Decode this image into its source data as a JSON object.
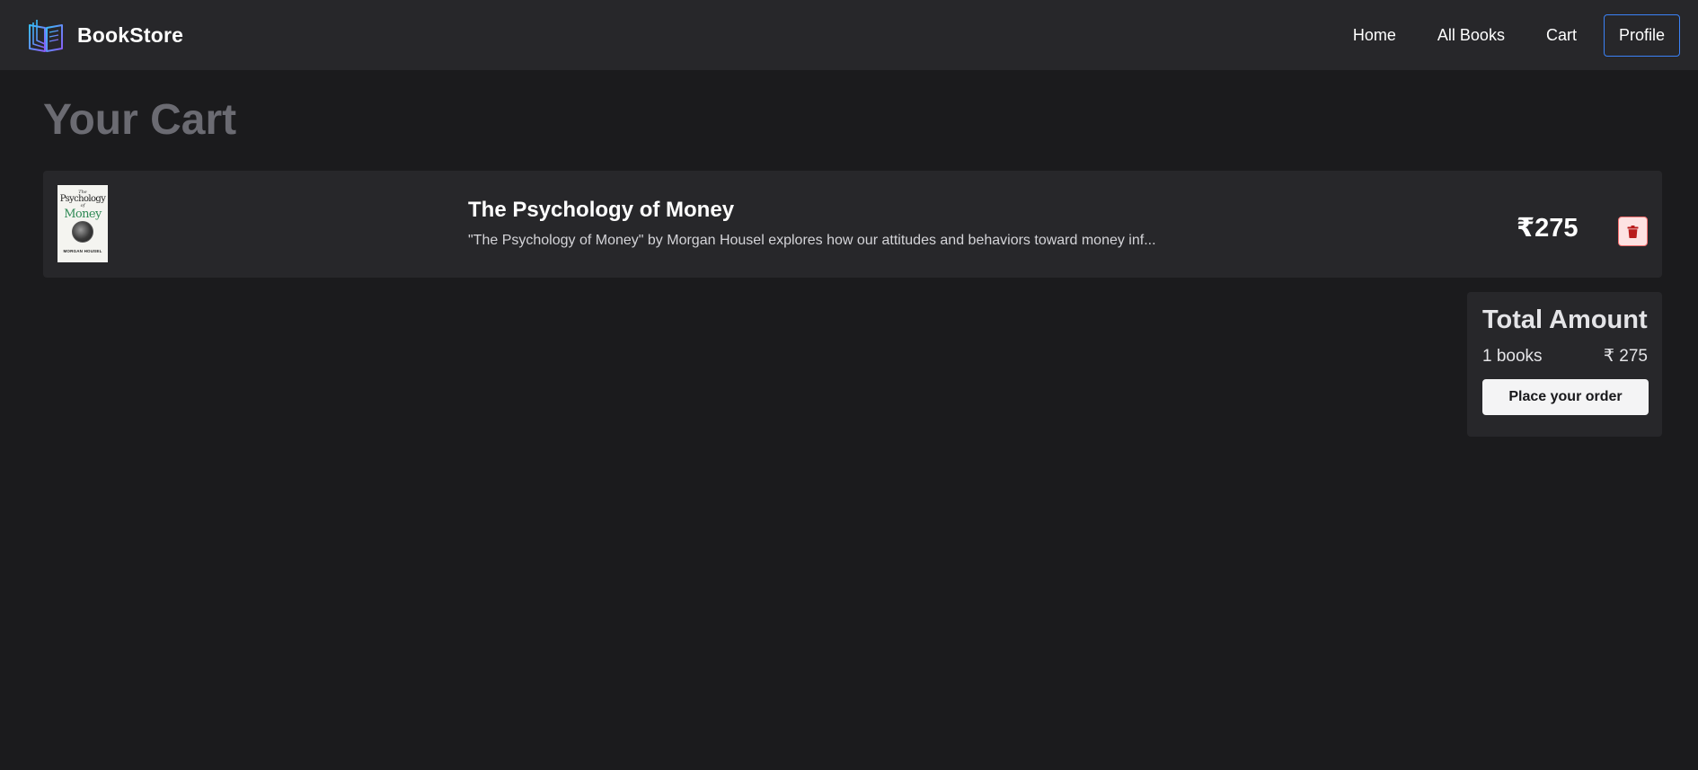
{
  "navbar": {
    "brand": "BookStore",
    "logo_icon": "open-book-icon",
    "links": [
      {
        "label": "Home"
      },
      {
        "label": "All Books"
      },
      {
        "label": "Cart"
      },
      {
        "label": "Profile"
      }
    ],
    "profile_border_color": "#3b82f6"
  },
  "page": {
    "title": "Your Cart"
  },
  "cart": {
    "items": [
      {
        "cover": {
          "the": "The",
          "line1": "Psychology",
          "line2": "of",
          "line3": "Money",
          "author": "MORGAN HOUSEL"
        },
        "title": "The Psychology of Money",
        "description": "\"The Psychology of Money\" by Morgan Housel explores how our attitudes and behaviors toward money inf...",
        "price": "₹275",
        "delete_icon": "trash-icon"
      }
    ]
  },
  "summary": {
    "heading": "Total Amount",
    "count_label": "1 books",
    "amount": "₹ 275",
    "button_label": "Place your order"
  },
  "colors": {
    "background": "#1b1b1d",
    "surface": "#27272a",
    "delete_bg": "#fde2e2",
    "delete_icon": "#b91c1c"
  }
}
